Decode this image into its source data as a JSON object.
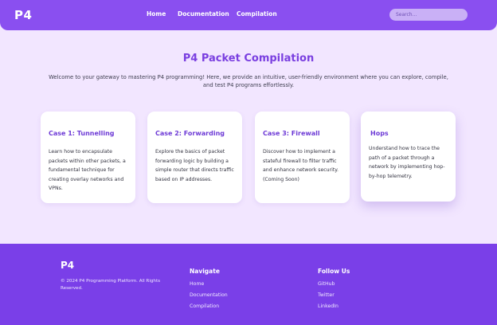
{
  "header": {
    "logo": "P4",
    "nav": [
      "Home",
      "Documentation",
      "Compilation"
    ],
    "search_placeholder": "Search..."
  },
  "hero": {
    "title": "P4 Packet Compilation",
    "subtitle": "Welcome to your gateway to mastering P4 programming! Here, we provide an intuitive, user-friendly environment where you can explore, compile, and test P4 programs effortlessly."
  },
  "cards": [
    {
      "title": "Case 1: Tunnelling",
      "description": "Learn how to encapsulate packets within other packets, a fundamental technique for creating overlay networks and VPNs."
    },
    {
      "title": "Case 2: Forwarding",
      "description": "Explore the basics of packet forwarding logic by building a simple router that directs traffic based on IP addresses."
    },
    {
      "title": "Case 3: Firewall",
      "description": "Discover how to implement a stateful firewall to filter traffic and enhance network security. (Coming Soon)"
    },
    {
      "title": "Hops",
      "description": "Understand how to trace the path of a packet through a network by implementing hop-by-hop telemetry."
    }
  ],
  "footer": {
    "logo": "P4",
    "copyright": "© 2024 P4 Programming Platform. All Rights Reserved.",
    "navigate": {
      "title": "Navigate",
      "links": [
        "Home",
        "Documentation",
        "Compilation"
      ]
    },
    "follow": {
      "title": "Follow Us",
      "links": [
        "GitHub",
        "Twitter",
        "LinkedIn"
      ]
    }
  },
  "colors": {
    "header_bg": "#8a4ff0",
    "page_bg": "#f2e6ff",
    "accent": "#7a3fe0",
    "footer_bg": "#7a3fe8"
  }
}
